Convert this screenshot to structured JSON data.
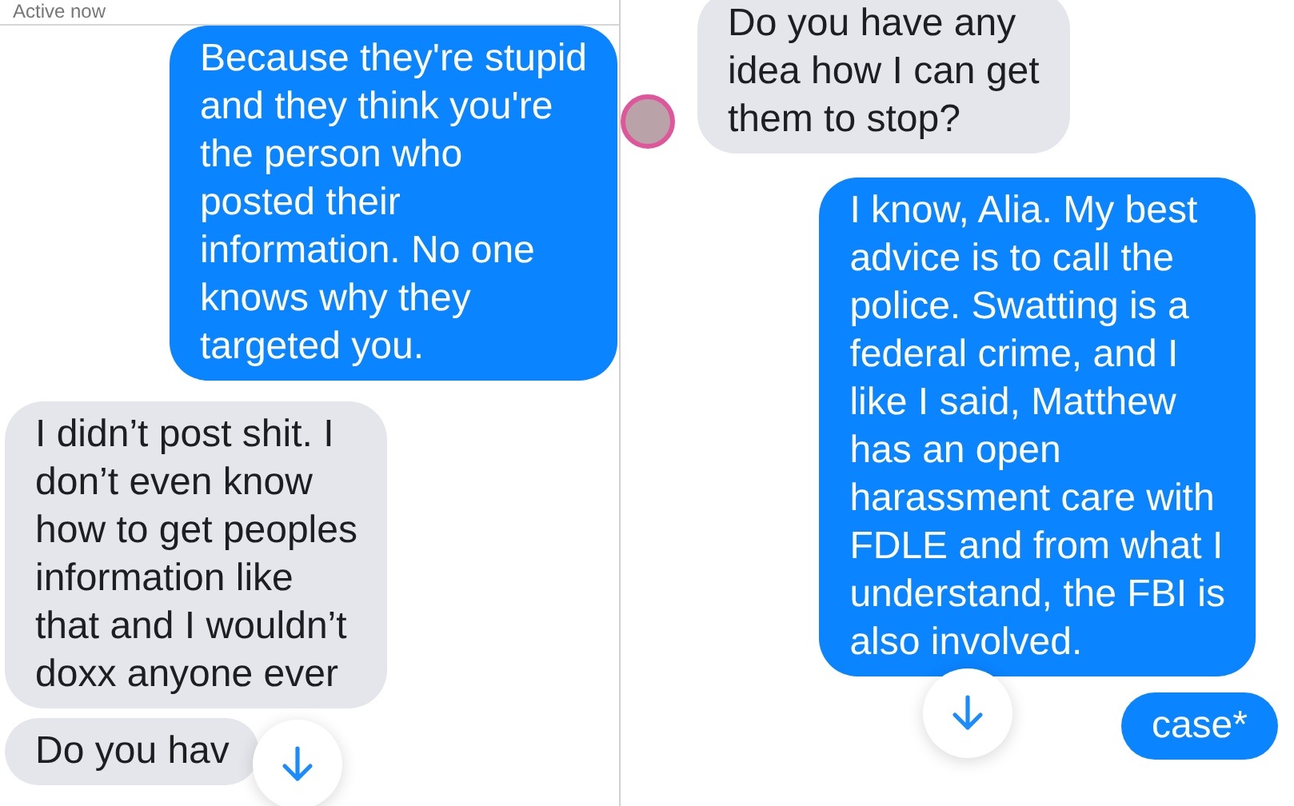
{
  "panels": [
    {
      "header": {
        "status": "Active now"
      },
      "messages": [
        {
          "kind": "sent",
          "text": "Because they're stupid\nand they think you're\nthe person who\nposted their\ninformation. No one\nknows why they\ntargeted you."
        },
        {
          "kind": "received",
          "text": "I didn’t post shit. I\ndon’t even know\nhow to get peoples\ninformation like\nthat and I wouldn’t\ndoxx anyone ever"
        },
        {
          "kind": "received",
          "text": "Do you hav"
        }
      ]
    },
    {
      "messages": [
        {
          "kind": "received",
          "avatar": true,
          "text": "Do you have any\nidea how I can get\nthem to stop?"
        },
        {
          "kind": "sent",
          "text": "I know, Alia. My best\nadvice is to call the\npolice. Swatting is a\nfederal crime, and I\nlike I said, Matthew\nhas an open\nharassment care with\nFDLE and from what I\nunderstand, the FBI is\nalso involved."
        },
        {
          "kind": "sent",
          "text": "case*"
        }
      ]
    }
  ]
}
